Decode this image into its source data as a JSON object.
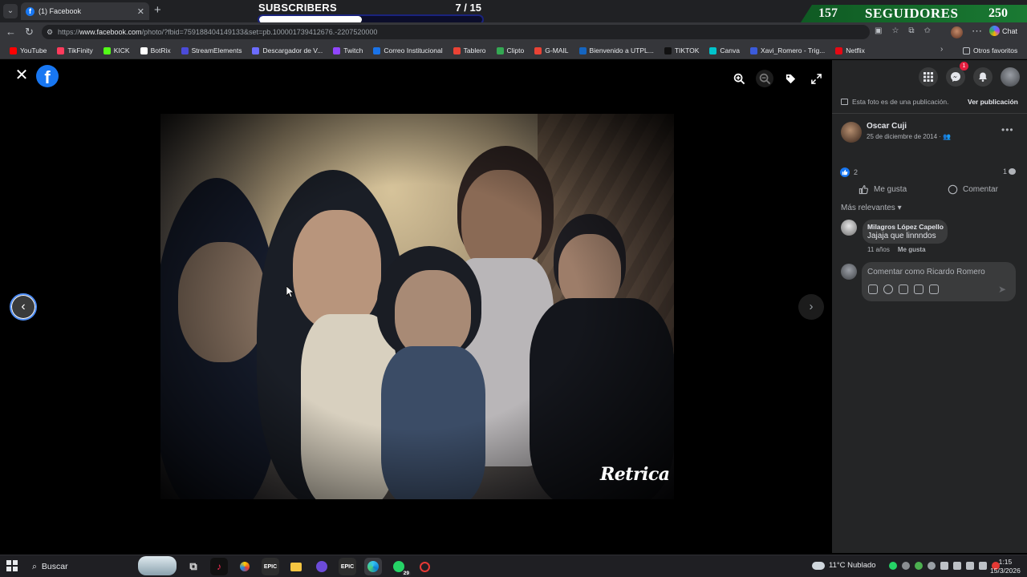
{
  "browser": {
    "tab_title": "(1) Facebook",
    "url_prefix": "https://",
    "url_host": "www.facebook.com",
    "url_rest": "/photo/?fbid=759188404149133&set=pb.100001739412676.-2207520000",
    "chat_label": "Chat",
    "bookmarks": [
      "YouTube",
      "TikFinity",
      "KICK",
      "BotRix",
      "StreamElements",
      "Descargador de V...",
      "Twitch",
      "Correo Institucional",
      "Tablero",
      "Clipto",
      "G-MAIL",
      "Bienvenido a UTPL...",
      "TIKTOK",
      "Canva",
      "Xavi_Romero - Trig...",
      "Netflix"
    ],
    "other_favorites": "Otros favoritos"
  },
  "overlays": {
    "subscribers_label": "SUBSCRIBERS",
    "subscribers_count": "7  / 15",
    "subscribers_progress": 0.46,
    "followers_current": "157",
    "followers_label": "SEGUIDORES",
    "followers_goal": "250"
  },
  "viewer": {
    "watermark": "Retrica"
  },
  "panel": {
    "notice": "Esta foto es de una publicación.",
    "notice_link": "Ver publicación",
    "author_name": "Oscar Cuji",
    "post_date": "25 de diciembre de 2014 ·",
    "like_count": "2",
    "comment_count": "1",
    "like_label": "Me gusta",
    "comment_label": "Comentar",
    "sort_label": "Más relevantes",
    "comment": {
      "author": "Milagros López Capello",
      "text": "Jajaja que linnndos",
      "age": "11 años",
      "like_label": "Me gusta"
    },
    "composer_placeholder": "Comentar como Ricardo Romero",
    "messenger_badge": "1"
  },
  "taskbar": {
    "search_label": "Buscar",
    "weather": "11°C  Nublado",
    "time": "1:15",
    "date": "15/3/2026",
    "whatsapp_badge": "29"
  }
}
